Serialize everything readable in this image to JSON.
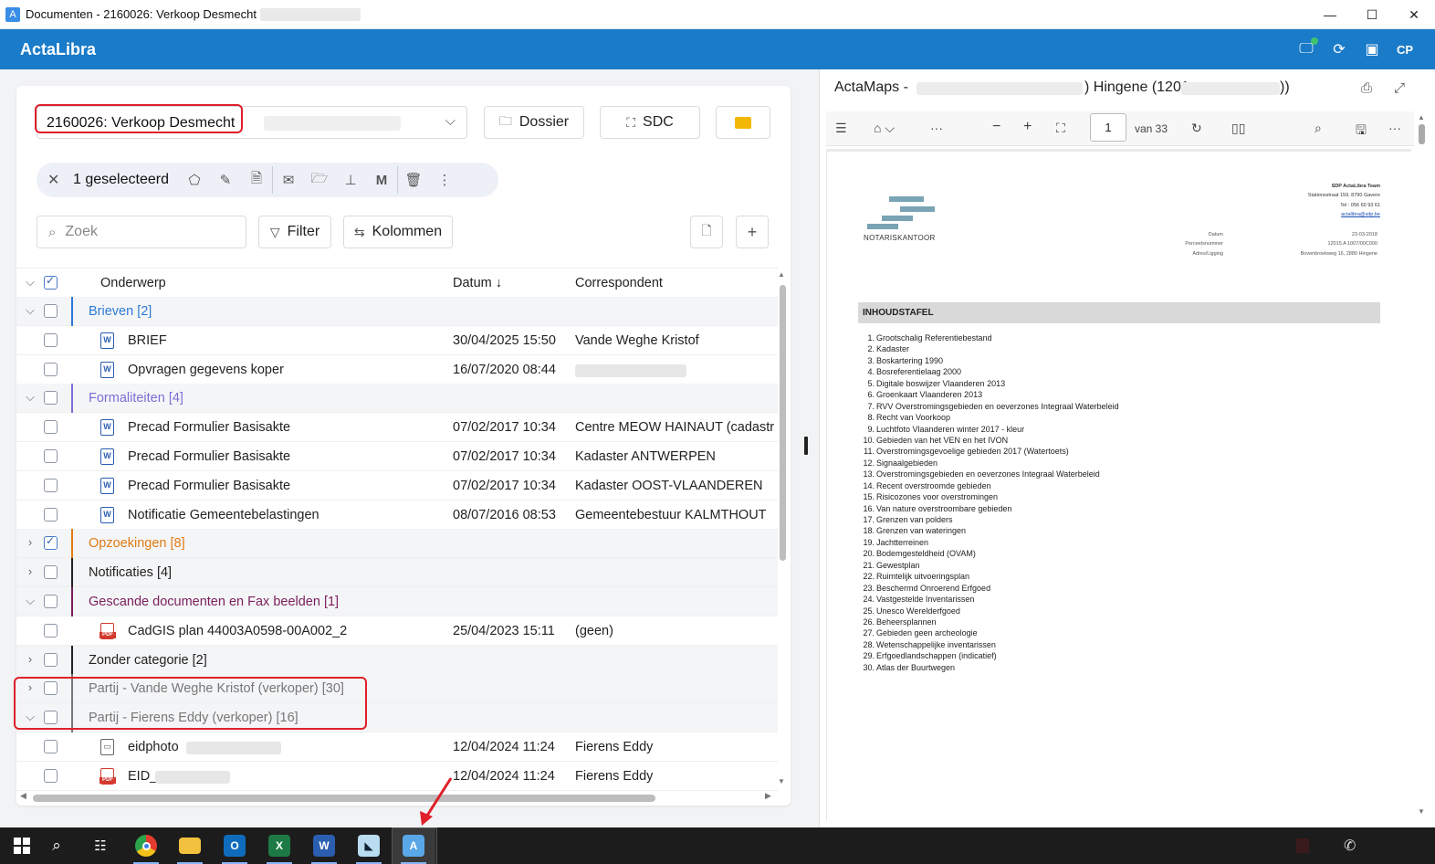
{
  "window": {
    "title": "Documenten - 2160026: Verkoop Desmecht",
    "app_icon": "A",
    "controls": {
      "minimize": "—",
      "maximize": "☐",
      "close": "✕"
    }
  },
  "appbar": {
    "brand": "ActaLibra",
    "user_initials": "CP",
    "accent": "#1a7bc8"
  },
  "left": {
    "dossier_value": "2160026: Verkoop Desmecht",
    "buttons": {
      "dossier": "Dossier",
      "sdc": "SDC"
    },
    "selection": {
      "count_label": "1 geselecteerd"
    },
    "search_placeholder": "Zoek",
    "filter_label": "Filter",
    "columns_label": "Kolommen",
    "grid": {
      "headers": {
        "subject": "Onderwerp",
        "date": "Datum",
        "correspondent": "Correspondent"
      },
      "rows": [
        {
          "kind": "group",
          "label": "Brieven [2]",
          "color": "#2b7bd6",
          "expanded": true,
          "checked": false
        },
        {
          "kind": "doc",
          "icon": "word",
          "subject": "BRIEF",
          "date": "30/04/2025 15:50",
          "correspondent": "Vande Weghe Kristof"
        },
        {
          "kind": "doc",
          "icon": "word",
          "subject": "Opvragen gegevens koper",
          "date": "16/07/2020 08:44",
          "correspondent": ""
        },
        {
          "kind": "group",
          "label": "Formaliteiten [4]",
          "color": "#7a6fd6",
          "expanded": true,
          "checked": false
        },
        {
          "kind": "doc",
          "icon": "word",
          "subject": "Precad Formulier Basisakte",
          "date": "07/02/2017 10:34",
          "correspondent": "Centre MEOW HAINAUT (cadastr"
        },
        {
          "kind": "doc",
          "icon": "word",
          "subject": "Precad Formulier Basisakte",
          "date": "07/02/2017 10:34",
          "correspondent": "Kadaster ANTWERPEN"
        },
        {
          "kind": "doc",
          "icon": "word",
          "subject": "Precad Formulier Basisakte",
          "date": "07/02/2017 10:34",
          "correspondent": "Kadaster OOST-VLAANDEREN"
        },
        {
          "kind": "doc",
          "icon": "word",
          "subject": "Notificatie Gemeentebelastingen",
          "date": "08/07/2016 08:53",
          "correspondent": "Gemeentebestuur KALMTHOUT"
        },
        {
          "kind": "group",
          "label": "Opzoekingen [8]",
          "color": "#e07b12",
          "expanded": false,
          "checked": true
        },
        {
          "kind": "group",
          "label": "Notificaties [4]",
          "color": "#222222",
          "expanded": false,
          "checked": false
        },
        {
          "kind": "group",
          "label": "Gescande documenten en Fax beelden [1]",
          "color": "#7a1f5c",
          "expanded": true,
          "checked": false
        },
        {
          "kind": "doc",
          "icon": "pdf",
          "subject": "CadGIS plan 44003A0598-00A002_2",
          "date": "25/04/2023 15:11",
          "correspondent": "(geen)"
        },
        {
          "kind": "group",
          "label": "Zonder categorie [2]",
          "color": "#222222",
          "expanded": false,
          "checked": false
        },
        {
          "kind": "group",
          "label": "Partij - Vande Weghe Kristof (verkoper) [30]",
          "color": "#777777",
          "expanded": false,
          "checked": false
        },
        {
          "kind": "group",
          "label": "Partij - Fierens Eddy (verkoper) [16]",
          "color": "#777777",
          "expanded": true,
          "checked": false
        },
        {
          "kind": "doc",
          "icon": "image",
          "subject": "eidphoto",
          "date": "12/04/2024 11:24",
          "correspondent": "Fierens Eddy"
        },
        {
          "kind": "doc",
          "icon": "pdf",
          "subject": "EID_",
          "date": "12/04/2024 11:24",
          "correspondent": "Fierens Eddy"
        }
      ]
    }
  },
  "right": {
    "title_prefix": "ActaMaps -",
    "title_mid": ") Hingene (1201",
    "title_end": "))",
    "pdf_toolbar": {
      "page": "1",
      "of_label": "van 33"
    },
    "pdf": {
      "logo_label": "NOTARISKANTOOR",
      "sender": [
        "SDP ActaLibra Team",
        "Stationsstraat 159, 8790 Gavere",
        "Tel : 056 60 93 61",
        "actalibra@sdp.be"
      ],
      "meta_labels": [
        "Datum",
        "Perceelsnummer",
        "Adres/Ligging"
      ],
      "meta_values": [
        "23-03-2018",
        "12015 A 1007/00C000",
        "Bovenbroekweg 16, 2880 Hingene"
      ],
      "toc_title": "INHOUDSTAFEL",
      "toc": [
        "Grootschalig Referentiebestand",
        "Kadaster",
        "Boskartering 1990",
        "Bosreferentielaag 2000",
        "Digitale boswijzer Vlaanderen 2013",
        "Groenkaart Vlaanderen 2013",
        "RVV Overstromingsgebieden en oeverzones Integraal Waterbeleid",
        "Recht van Voorkoop",
        "Luchtfoto Vlaanderen winter 2017 - kleur",
        "Gebieden van het VEN en het IVON",
        "Overstromingsgevoelige gebieden 2017 (Watertoets)",
        "Signaalgebieden",
        "Overstromingsgebieden en oeverzones Integraal Waterbeleid",
        "Recent overstroomde gebieden",
        "Risicozones voor overstromingen",
        "Van nature overstroombare gebieden",
        "Grenzen van polders",
        "Grenzen van wateringen",
        "Jachtterreinen",
        "Bodemgesteldheid (OVAM)",
        "Gewestplan",
        "Ruimtelijk uitvoeringsplan",
        "Beschermd Onroerend Erfgoed",
        "Vastgestelde Inventarissen",
        "Unesco Werelderfgoed",
        "Beheersplannen",
        "Gebieden geen archeologie",
        "Wetenschappelijke inventarissen",
        "Erfgoedlandschappen (indicatief)",
        "Atlas der Buurtwegen"
      ]
    }
  },
  "taskbar": {
    "apps": [
      "start",
      "search",
      "task-view",
      "chrome",
      "file-explorer",
      "outlook",
      "excel",
      "word",
      "app-dolphin",
      "actalibra"
    ]
  }
}
